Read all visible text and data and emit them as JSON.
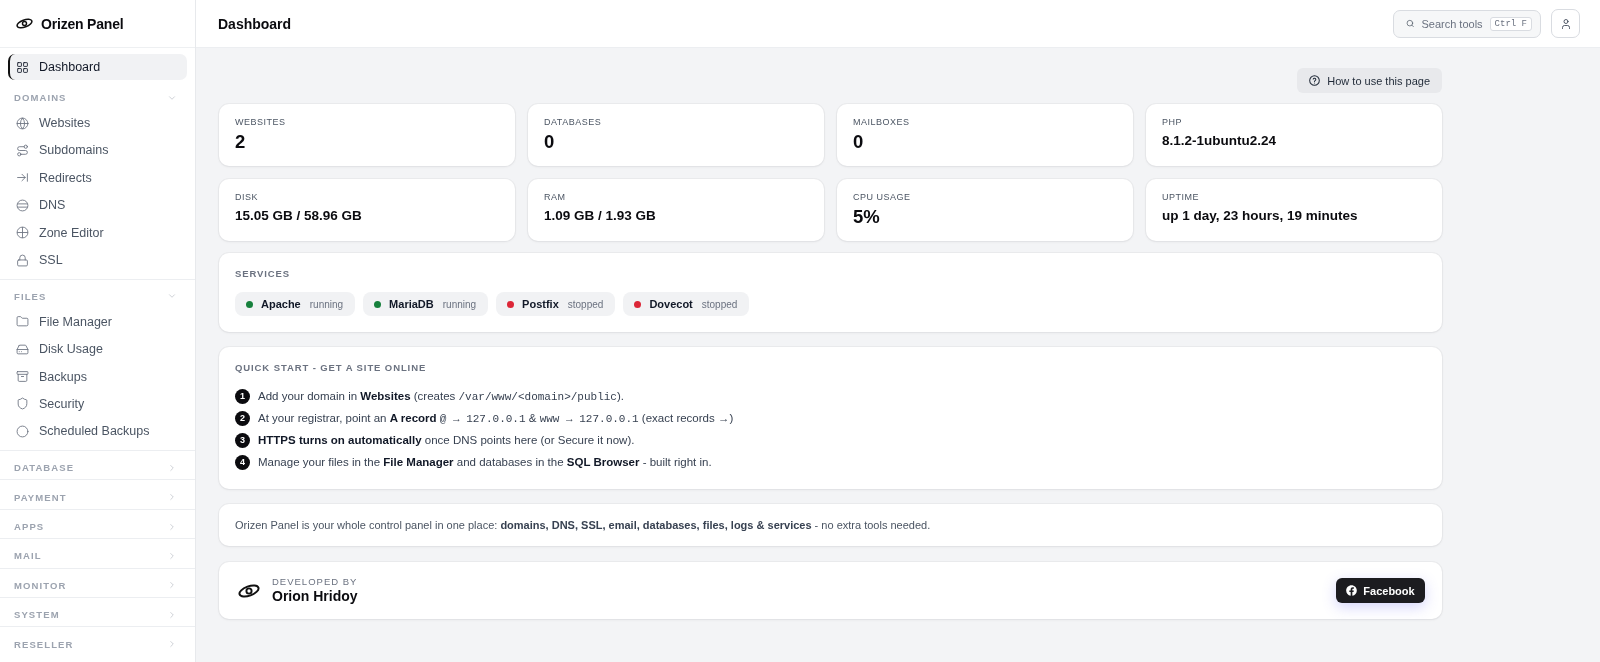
{
  "sidebar": {
    "brand": "Orizen Panel",
    "items": [
      {
        "label": "Dashboard",
        "selected": true
      }
    ],
    "sections": [
      {
        "label": "DOMAINS",
        "expanded": true,
        "items": [
          {
            "label": "Websites",
            "selected": false
          },
          {
            "label": "Subdomains",
            "selected": false
          },
          {
            "label": "Redirects",
            "selected": false
          },
          {
            "label": "DNS",
            "selected": false
          },
          {
            "label": "Zone Editor",
            "selected": false
          },
          {
            "label": "SSL",
            "selected": false
          }
        ]
      },
      {
        "label": "FILES",
        "expanded": true,
        "items": [
          {
            "label": "File Manager",
            "selected": false
          },
          {
            "label": "Disk Usage",
            "selected": false
          },
          {
            "label": "Backups",
            "selected": false
          },
          {
            "label": "Security",
            "selected": false
          },
          {
            "label": "Scheduled Backups",
            "selected": false
          }
        ]
      },
      {
        "label": "DATABASE",
        "expanded": false
      },
      {
        "label": "PAYMENT",
        "expanded": false
      },
      {
        "label": "APPS",
        "expanded": false
      },
      {
        "label": "MAIL",
        "expanded": false
      },
      {
        "label": "MONITOR",
        "expanded": false
      },
      {
        "label": "SYSTEM",
        "expanded": false
      },
      {
        "label": "RESELLER",
        "expanded": false
      }
    ]
  },
  "header": {
    "title": "Dashboard",
    "search": {
      "label": "Search tools",
      "shortcut": "Ctrl F"
    }
  },
  "help_button": "How to use this page",
  "stats": [
    {
      "label": "WEBSITES",
      "value": "2",
      "kind": "metric"
    },
    {
      "label": "DATABASES",
      "value": "0",
      "kind": "metric"
    },
    {
      "label": "MAILBOXES",
      "value": "0",
      "kind": "metric"
    },
    {
      "label": "PHP",
      "value": "8.1.2-1ubuntu2.24",
      "kind": "detail"
    },
    {
      "label": "DISK",
      "value": "15.05 GB / 58.96 GB",
      "kind": "detail"
    },
    {
      "label": "RAM",
      "value": "1.09 GB / 1.93 GB",
      "kind": "detail"
    },
    {
      "label": "CPU USAGE",
      "value": "5%",
      "kind": "metric"
    },
    {
      "label": "UPTIME",
      "value": "up 1 day, 23 hours, 19 minutes",
      "kind": "detail"
    }
  ],
  "services": {
    "title": "SERVICES",
    "items": [
      {
        "name": "Apache",
        "status": "running",
        "color": "#16803c"
      },
      {
        "name": "MariaDB",
        "status": "running",
        "color": "#16803c"
      },
      {
        "name": "Postfix",
        "status": "stopped",
        "color": "#dc2637"
      },
      {
        "name": "Dovecot",
        "status": "stopped",
        "color": "#dc2637"
      }
    ]
  },
  "quick_start": {
    "title": "QUICK START - GET A SITE ONLINE",
    "steps": [
      {
        "number": "1",
        "parts": [
          {
            "kind": "text",
            "text": "Add your domain in "
          },
          {
            "kind": "bold",
            "text": "Websites"
          },
          {
            "kind": "text",
            "text": " (creates "
          },
          {
            "kind": "code",
            "text": "/var/www/<domain>/public"
          },
          {
            "kind": "text",
            "text": ")."
          }
        ]
      },
      {
        "number": "2",
        "parts": [
          {
            "kind": "text",
            "text": "At your registrar, point an "
          },
          {
            "kind": "bold",
            "text": "A record "
          },
          {
            "kind": "code",
            "text": "@ → 127.0.0.1"
          },
          {
            "kind": "text",
            "text": " & "
          },
          {
            "kind": "code",
            "text": "www → 127.0.0.1"
          },
          {
            "kind": "text",
            "text": " (exact records →)"
          }
        ]
      },
      {
        "number": "3",
        "parts": [
          {
            "kind": "bold",
            "text": "HTTPS turns on automatically"
          },
          {
            "kind": "text",
            "text": " once DNS points here (or Secure it now)."
          }
        ]
      },
      {
        "number": "4",
        "parts": [
          {
            "kind": "text",
            "text": "Manage your files in the "
          },
          {
            "kind": "bold",
            "text": "File Manager"
          },
          {
            "kind": "text",
            "text": " and databases in the "
          },
          {
            "kind": "bold",
            "text": "SQL Browser"
          },
          {
            "kind": "text",
            "text": " - built right in."
          }
        ]
      }
    ]
  },
  "info": "Orizen Panel is your whole control panel in one place: **domains, DNS, SSL, email, databases, files, logs & services** - no extra tools needed.",
  "developer": {
    "caption": "DEVELOPED BY",
    "name": "Orion Hridoy",
    "button": "Facebook"
  }
}
